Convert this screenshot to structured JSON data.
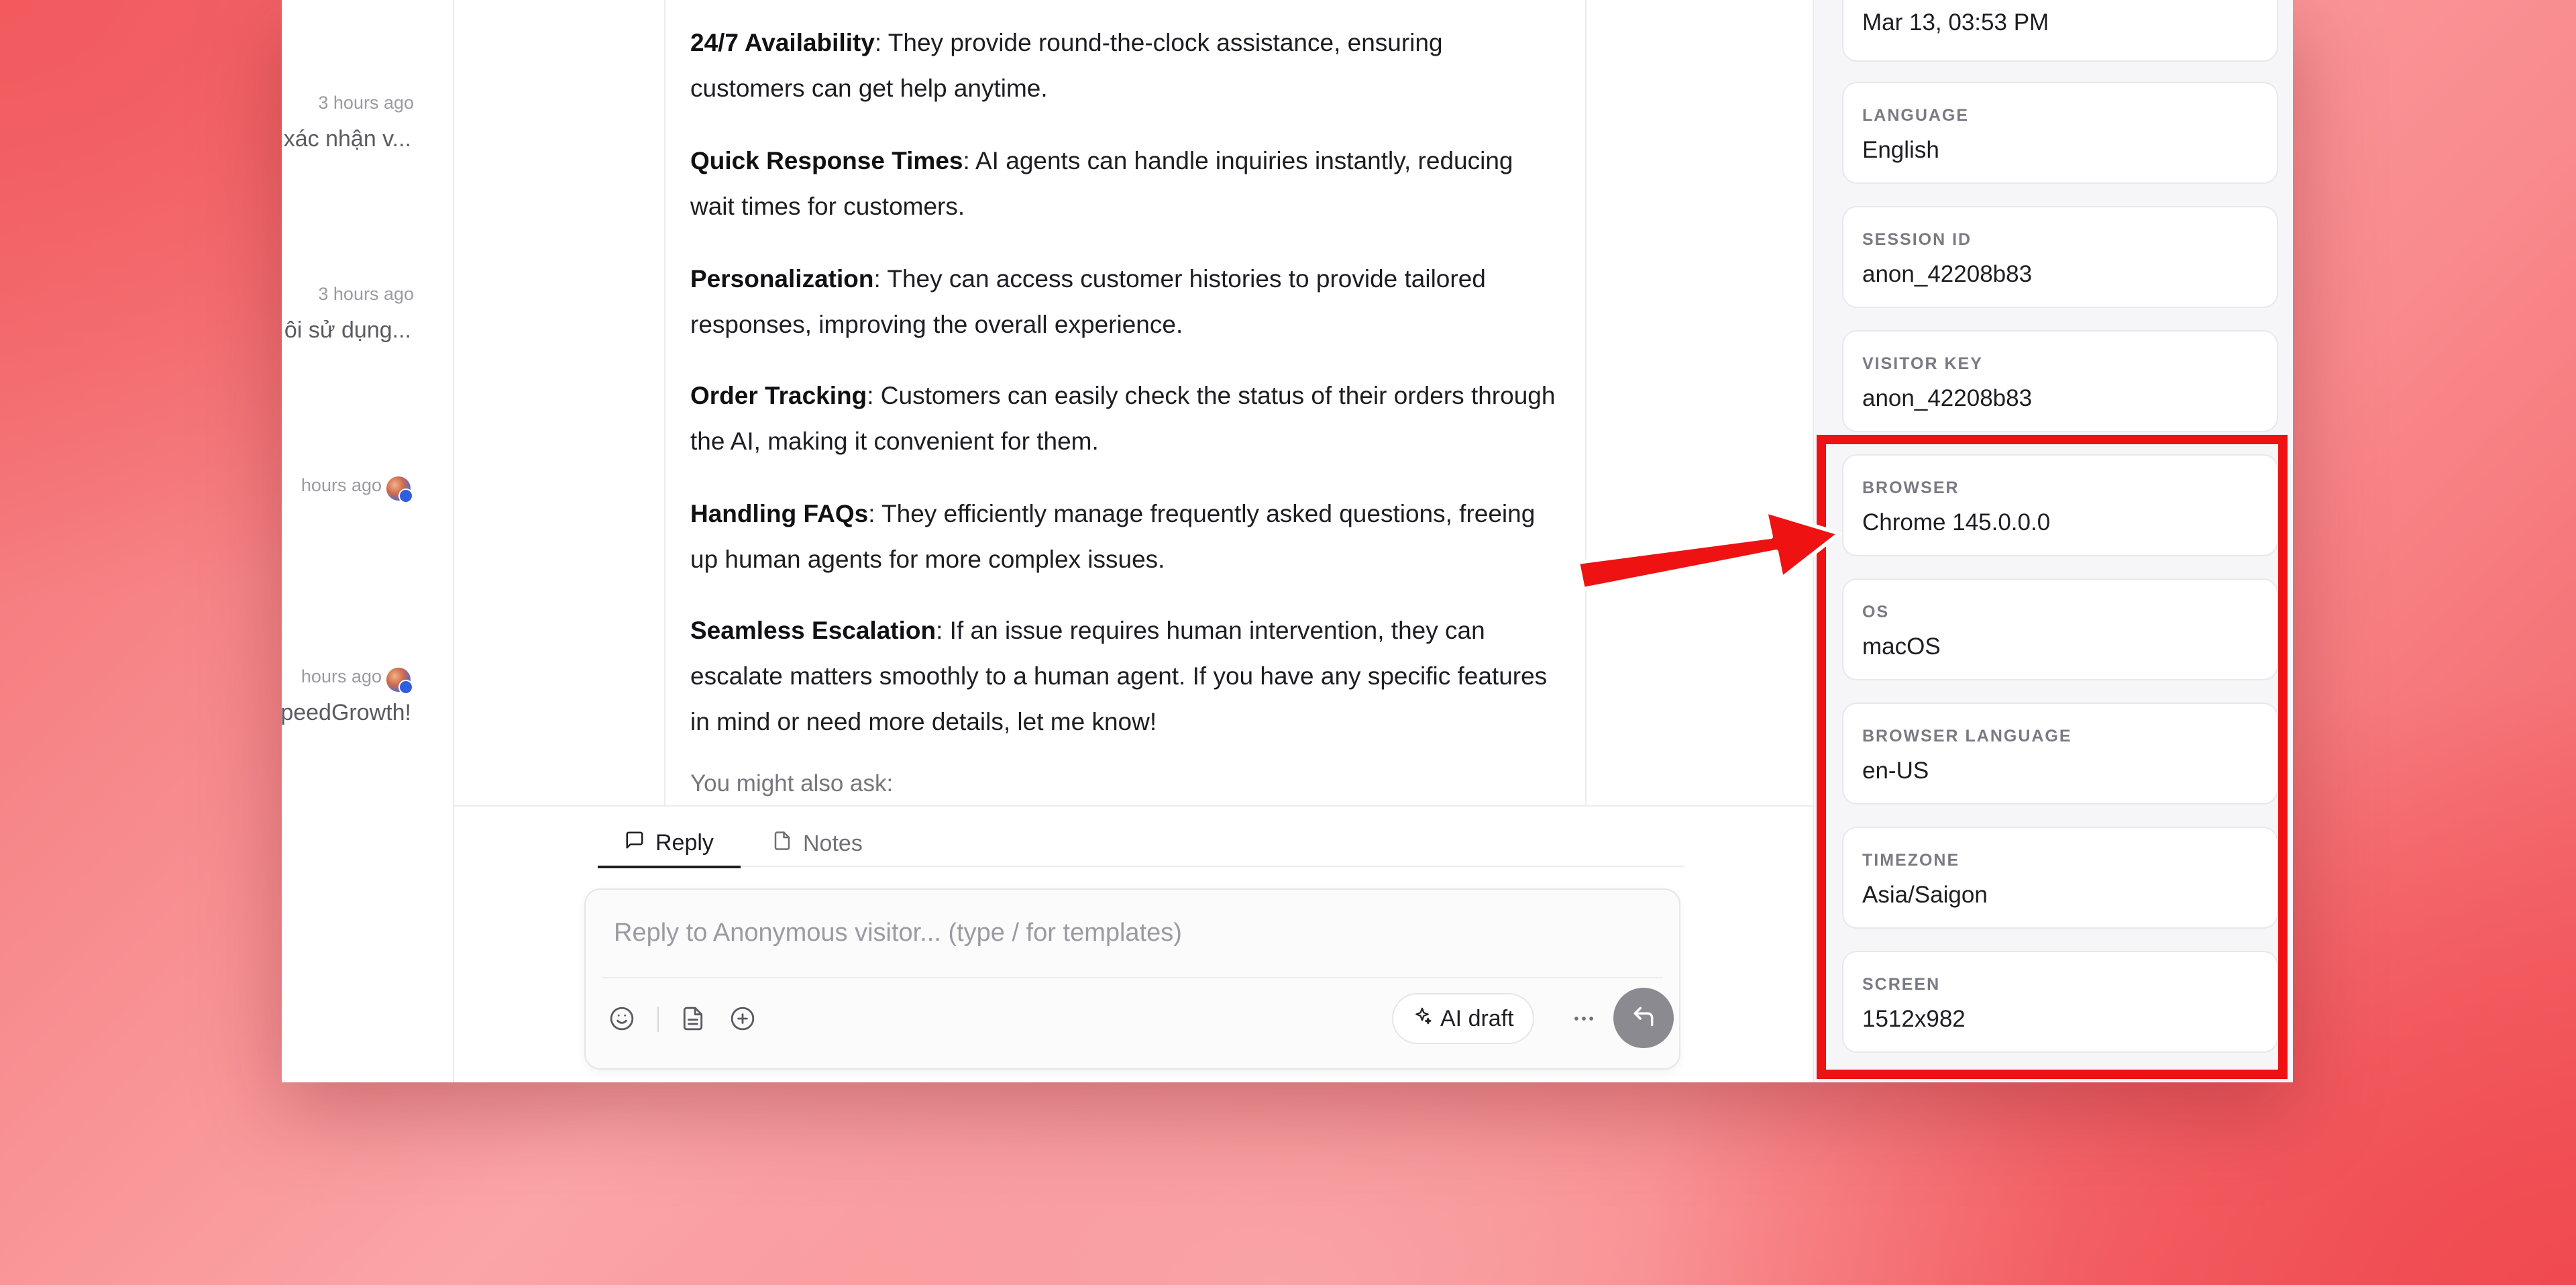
{
  "conversations": [
    {
      "time": "3 hours ago",
      "preview": "xác nhận v...",
      "avatar": false
    },
    {
      "time": "3 hours ago",
      "preview": "ôi sử dụng...",
      "avatar": false
    },
    {
      "time": "hours ago",
      "preview": "",
      "avatar": true
    },
    {
      "time": "hours ago",
      "preview": "peedGrowth!",
      "avatar": true
    }
  ],
  "message": {
    "paragraphs": [
      {
        "title": "24/7 Availability",
        "text": ": They provide round-the-clock assistance, ensuring customers can get help anytime."
      },
      {
        "title": "Quick Response Times",
        "text": ": AI agents can handle inquiries instantly, reducing wait times for customers."
      },
      {
        "title": "Personalization",
        "text": ": They can access customer histories to provide tailored responses, improving the overall experience."
      },
      {
        "title": "Order Tracking",
        "text": ": Customers can easily check the status of their orders through the AI, making it convenient for them."
      },
      {
        "title": "Handling FAQs",
        "text": ": They efficiently manage frequently asked questions, freeing up human agents for more complex issues."
      },
      {
        "title": "Seamless Escalation",
        "text": ": If an issue requires human intervention, they can escalate matters smoothly to a human agent. If you have any specific features in mind or need more details, let me know!"
      }
    ],
    "suggestions_label": "You might also ask:"
  },
  "composer": {
    "tabs": [
      {
        "label": "Reply",
        "icon": "message-square-icon",
        "active": true
      },
      {
        "label": "Notes",
        "icon": "file-icon",
        "active": false
      }
    ],
    "placeholder": "Reply to Anonymous visitor... (type / for templates)",
    "ai_draft_label": "AI draft",
    "icons": [
      "smile-icon",
      "file-text-icon",
      "plus-circle-icon",
      "sparkles-icon",
      "more-horizontal-icon",
      "send-reply-icon"
    ]
  },
  "sidebar": {
    "fields": [
      {
        "label": "",
        "value": "Mar 13, 03:53 PM"
      },
      {
        "label": "LANGUAGE",
        "value": "English"
      },
      {
        "label": "SESSION ID",
        "value": "anon_42208b83"
      },
      {
        "label": "VISITOR KEY",
        "value": "anon_42208b83"
      },
      {
        "label": "BROWSER",
        "value": "Chrome 145.0.0.0"
      },
      {
        "label": "OS",
        "value": "macOS"
      },
      {
        "label": "BROWSER LANGUAGE",
        "value": "en-US"
      },
      {
        "label": "TIMEZONE",
        "value": "Asia/Saigon"
      },
      {
        "label": "SCREEN",
        "value": "1512x982"
      }
    ]
  },
  "annotation": {
    "highlight_color": "#ee1212",
    "arrow_color": "#ee1212"
  }
}
